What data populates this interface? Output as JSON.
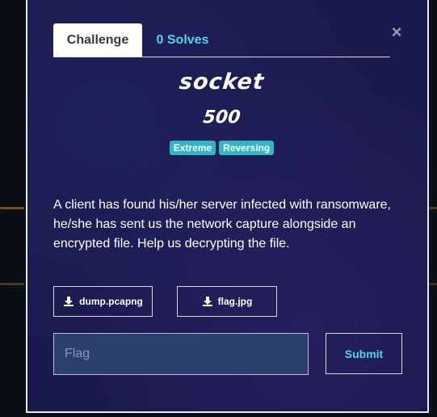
{
  "modal": {
    "close_symbol": "×",
    "tabs": [
      {
        "label": "Challenge"
      },
      {
        "label": "0 Solves"
      }
    ],
    "challenge": {
      "name": "socket",
      "points": "500",
      "tags": [
        "Extreme",
        "Reversing"
      ],
      "description": "A client has found his/her server infected with ransomware, he/she has sent us the network capture alongside an encrypted file. Help us decrypting the file."
    },
    "files": [
      {
        "label": "dump.pcapng",
        "icon": "download-icon"
      },
      {
        "label": "flag.jpg",
        "icon": "download-icon"
      }
    ],
    "flag_input": {
      "placeholder": "Flag",
      "value": ""
    },
    "submit_label": "Submit"
  },
  "colors": {
    "modal_bg": "#1a1a4e",
    "accent": "#4fd6e8",
    "tag_bg": "#2fb8c4",
    "input_bg": "#2b3f6e"
  }
}
